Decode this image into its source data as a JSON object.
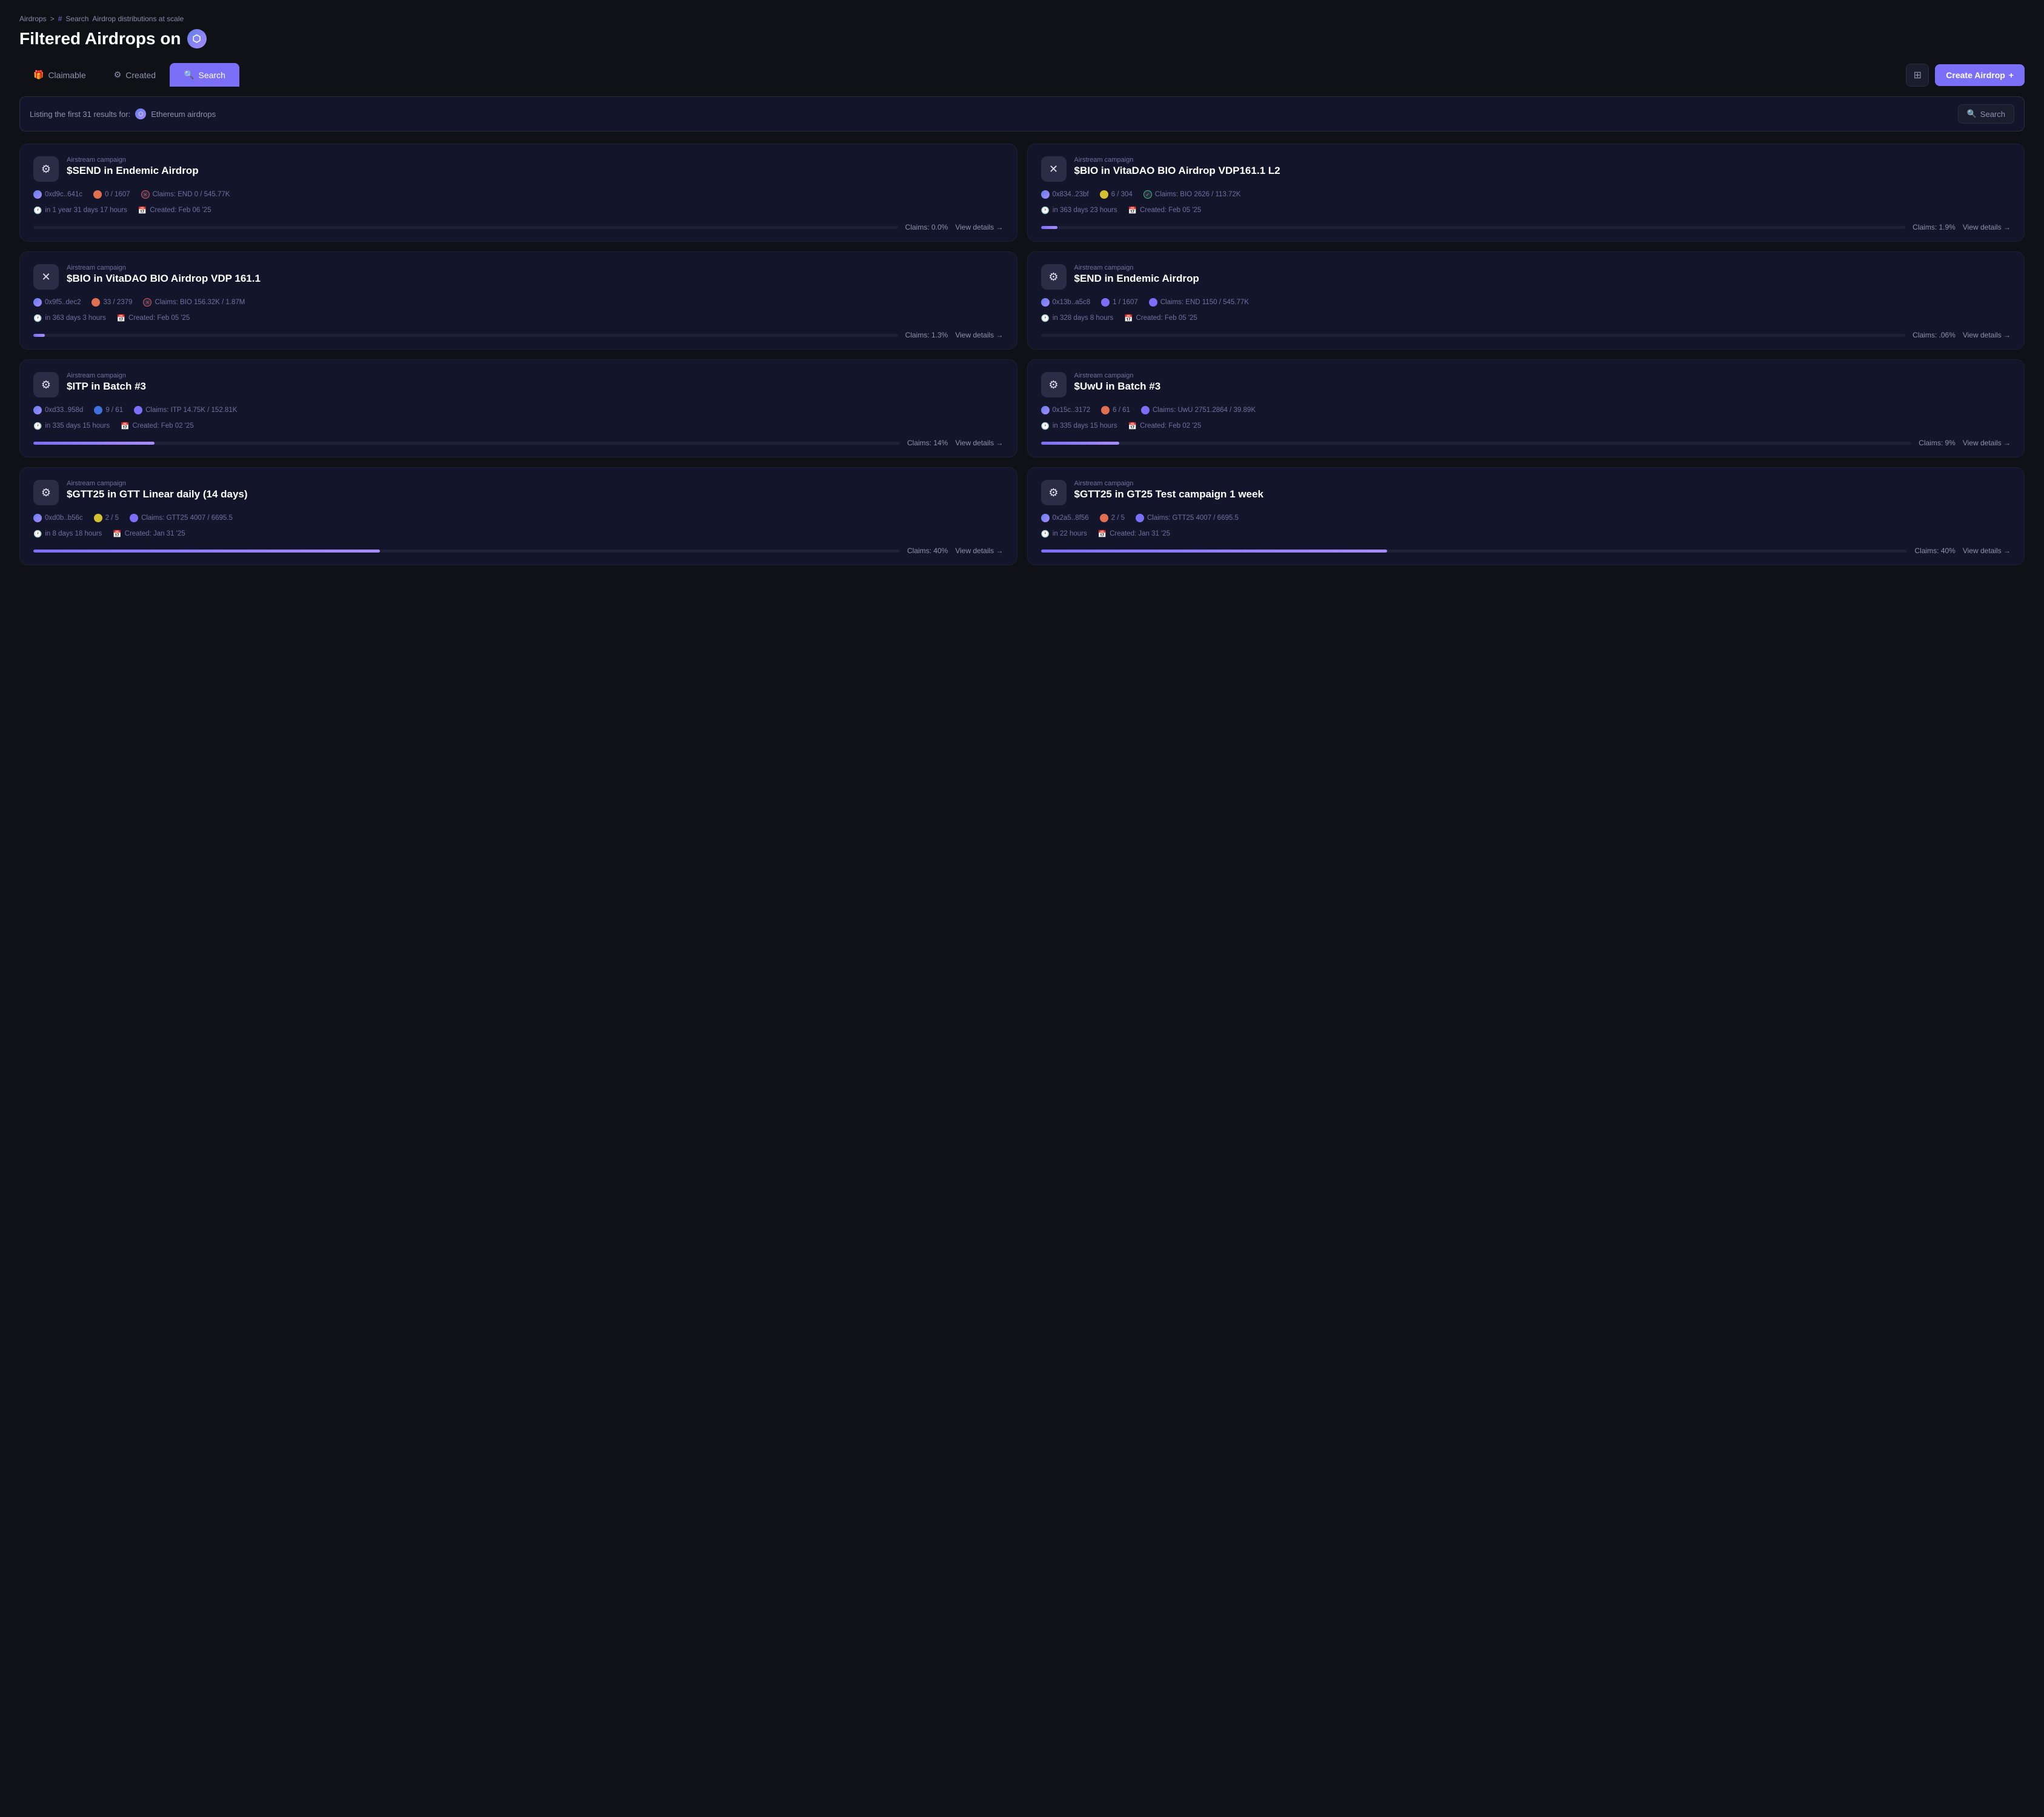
{
  "breadcrumb": {
    "root": "Airdrops",
    "sep": ">",
    "hash": "#",
    "current": "Search",
    "subtitle": "Airdrop distributions at scale"
  },
  "page_title": "Filtered Airdrops on",
  "tabs": [
    {
      "id": "claimable",
      "label": "Claimable",
      "icon": "🎁",
      "active": false
    },
    {
      "id": "created",
      "label": "Created",
      "icon": "⚙",
      "active": false
    },
    {
      "id": "search",
      "label": "Search",
      "icon": "🔍",
      "active": true
    }
  ],
  "btn_grid_label": "⊞",
  "btn_create_label": "Create Airdrop",
  "search_bar": {
    "listing_text": "Listing the first 31 results for:",
    "network": "Ethereum airdrops",
    "search_label": "Search"
  },
  "cards": [
    {
      "id": 1,
      "type": "Airstream campaign",
      "name": "$SEND in Endemic Airdrop",
      "icon": "⚙",
      "icon_style": "gear",
      "meta": [
        {
          "dot": "eth",
          "text": "0xd9c..641c"
        },
        {
          "dot": "orange",
          "text": "0 / 1607"
        },
        {
          "dot": "x-badge",
          "text": "Claims: END 0 / 545.77K"
        }
      ],
      "time": "in 1 year 31 days 17 hours",
      "created": "Created: Feb 06 '25",
      "claims_pct": "0.0%",
      "progress": 0.0,
      "view_details": "View details"
    },
    {
      "id": 2,
      "type": "Airstream campaign",
      "name": "$BIO in VitaDAO BIO Airdrop VDP161.1 L2",
      "icon": "✕",
      "icon_style": "bio",
      "meta": [
        {
          "dot": "eth",
          "text": "0x834..23bf"
        },
        {
          "dot": "yellow",
          "text": "6 / 304"
        },
        {
          "dot": "check-badge",
          "text": "Claims: BIO 2626 / 113.72K"
        }
      ],
      "time": "in 363 days 23 hours",
      "created": "Created: Feb 05 '25",
      "claims_pct": "1.9%",
      "progress": 1.9,
      "view_details": "View details"
    },
    {
      "id": 3,
      "type": "Airstream campaign",
      "name": "$BIO in VitaDAO BIO Airdrop VDP 161.1",
      "icon": "✕",
      "icon_style": "bio",
      "meta": [
        {
          "dot": "eth",
          "text": "0x9f5..dec2"
        },
        {
          "dot": "orange",
          "text": "33 / 2379"
        },
        {
          "dot": "x-badge",
          "text": "Claims: BIO 156.32K / 1.87M"
        }
      ],
      "time": "in 363 days 3 hours",
      "created": "Created: Feb 05 '25",
      "claims_pct": "1.3%",
      "progress": 1.3,
      "view_details": "View details"
    },
    {
      "id": 4,
      "type": "Airstream campaign",
      "name": "$END in Endemic Airdrop",
      "icon": "⚙",
      "icon_style": "gear",
      "meta": [
        {
          "dot": "eth",
          "text": "0x13b..a5c8"
        },
        {
          "dot": "purple",
          "text": "1 / 1607"
        },
        {
          "dot": "purple",
          "text": "Claims: END 1150 / 545.77K"
        }
      ],
      "time": "in 328 days 8 hours",
      "created": "Created: Feb 05 '25",
      "claims_pct": ".06%",
      "progress": 0.06,
      "view_details": "View details"
    },
    {
      "id": 5,
      "type": "Airstream campaign",
      "name": "$ITP in Batch #3",
      "icon": "⚙",
      "icon_style": "gear",
      "meta": [
        {
          "dot": "eth",
          "text": "0xd33..958d"
        },
        {
          "dot": "blue",
          "text": "9 / 61"
        },
        {
          "dot": "purple",
          "text": "Claims: ITP 14.75K / 152.81K"
        }
      ],
      "time": "in 335 days 15 hours",
      "created": "Created: Feb 02 '25",
      "claims_pct": "14%",
      "progress": 14,
      "view_details": "View details"
    },
    {
      "id": 6,
      "type": "Airstream campaign",
      "name": "$UwU in Batch #3",
      "icon": "⚙",
      "icon_style": "gear",
      "meta": [
        {
          "dot": "eth",
          "text": "0x15c..3172"
        },
        {
          "dot": "orange",
          "text": "6 / 61"
        },
        {
          "dot": "purple",
          "text": "Claims: UwU 2751.2864 / 39.89K"
        }
      ],
      "time": "in 335 days 15 hours",
      "created": "Created: Feb 02 '25",
      "claims_pct": "9%",
      "progress": 9,
      "view_details": "View details"
    },
    {
      "id": 7,
      "type": "Airstream campaign",
      "name": "$GTT25 in GTT Linear daily (14 days)",
      "icon": "⚙",
      "icon_style": "gear",
      "meta": [
        {
          "dot": "eth",
          "text": "0xd0b..b56c"
        },
        {
          "dot": "yellow",
          "text": "2 / 5"
        },
        {
          "dot": "purple",
          "text": "Claims: GTT25 4007 / 6695.5"
        }
      ],
      "time": "in 8 days 18 hours",
      "created": "Created: Jan 31 '25",
      "claims_pct": "40%",
      "progress": 40,
      "view_details": "View details"
    },
    {
      "id": 8,
      "type": "Airstream campaign",
      "name": "$GTT25 in GT25 Test campaign 1 week",
      "icon": "⚙",
      "icon_style": "gear",
      "meta": [
        {
          "dot": "eth",
          "text": "0x2a5..8f56"
        },
        {
          "dot": "orange",
          "text": "2 / 5"
        },
        {
          "dot": "purple",
          "text": "Claims: GTT25 4007 / 6695.5"
        }
      ],
      "time": "in 22 hours",
      "created": "Created: Jan 31 '25",
      "claims_pct": "40%",
      "progress": 40,
      "view_details": "View details"
    }
  ]
}
